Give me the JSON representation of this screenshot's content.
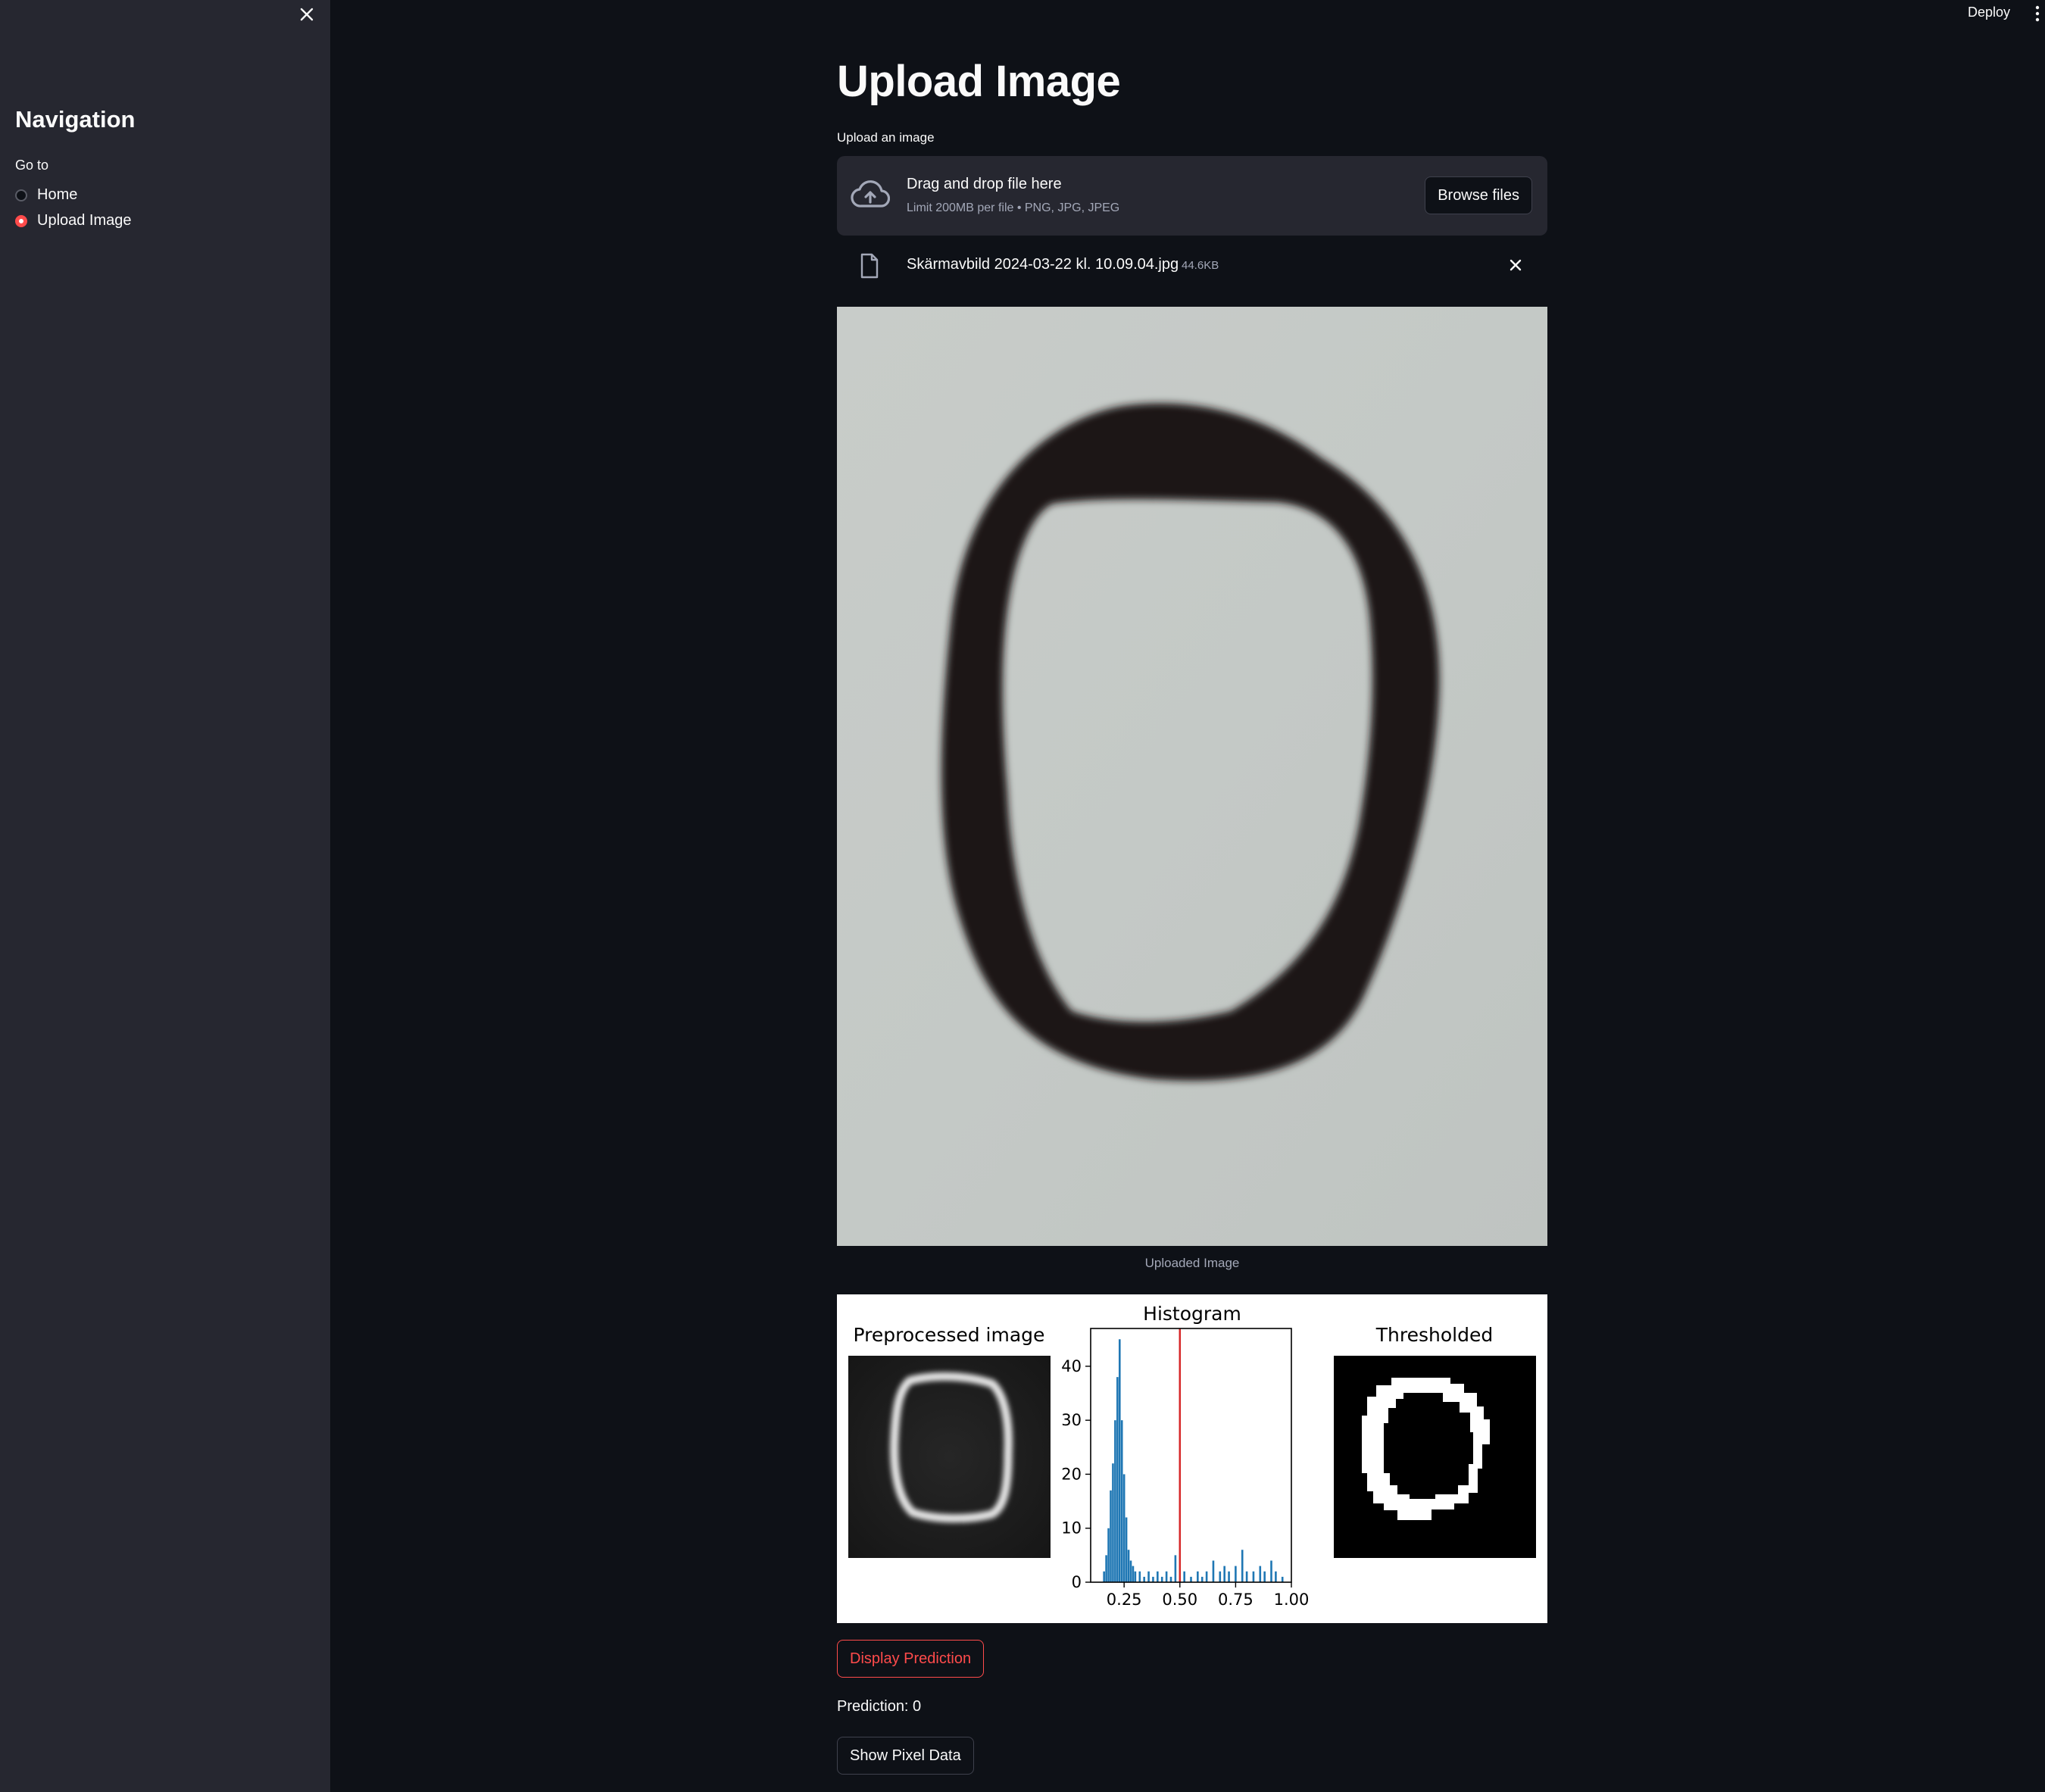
{
  "sidebar": {
    "title": "Navigation",
    "goto_label": "Go to",
    "options": [
      {
        "label": "Home",
        "selected": false
      },
      {
        "label": "Upload Image",
        "selected": true
      }
    ]
  },
  "topbar": {
    "deploy_label": "Deploy"
  },
  "main": {
    "title": "Upload Image",
    "uploader": {
      "label": "Upload an image",
      "drop_text": "Drag and drop file here",
      "limit_text": "Limit 200MB per file • PNG, JPG, JPEG",
      "browse_label": "Browse files"
    },
    "file": {
      "name": "Skärmavbild 2024-03-22 kl. 10.09.04.jpg",
      "size": "44.6KB"
    },
    "image_caption": "Uploaded Image",
    "predict_button": "Display Prediction",
    "prediction_text": "Prediction: 0",
    "pixel_button": "Show Pixel Data"
  },
  "figure": {
    "panels": [
      {
        "title": "Preprocessed image"
      },
      {
        "title": "Histogram"
      },
      {
        "title": "Thresholded"
      }
    ]
  },
  "chart_data": {
    "type": "bar",
    "title": "Histogram",
    "xlabel": "",
    "ylabel": "",
    "xlim": [
      0.1,
      1.0
    ],
    "ylim": [
      0,
      47
    ],
    "xticks": [
      "0.25",
      "0.50",
      "0.75",
      "1.00"
    ],
    "yticks": [
      "0",
      "10",
      "20",
      "30",
      "40"
    ],
    "bar_color": "#1f77b4",
    "threshold": {
      "value": 0.5,
      "color": "#d62728"
    },
    "bins": [
      {
        "x": 0.16,
        "count": 2
      },
      {
        "x": 0.17,
        "count": 5
      },
      {
        "x": 0.18,
        "count": 10
      },
      {
        "x": 0.19,
        "count": 17
      },
      {
        "x": 0.2,
        "count": 22
      },
      {
        "x": 0.21,
        "count": 30
      },
      {
        "x": 0.22,
        "count": 38
      },
      {
        "x": 0.23,
        "count": 45
      },
      {
        "x": 0.24,
        "count": 30
      },
      {
        "x": 0.25,
        "count": 20
      },
      {
        "x": 0.26,
        "count": 12
      },
      {
        "x": 0.27,
        "count": 6
      },
      {
        "x": 0.28,
        "count": 4
      },
      {
        "x": 0.29,
        "count": 3
      },
      {
        "x": 0.3,
        "count": 2
      },
      {
        "x": 0.32,
        "count": 2
      },
      {
        "x": 0.34,
        "count": 1
      },
      {
        "x": 0.36,
        "count": 2
      },
      {
        "x": 0.38,
        "count": 1
      },
      {
        "x": 0.4,
        "count": 2
      },
      {
        "x": 0.42,
        "count": 1
      },
      {
        "x": 0.44,
        "count": 2
      },
      {
        "x": 0.46,
        "count": 1
      },
      {
        "x": 0.48,
        "count": 5
      },
      {
        "x": 0.52,
        "count": 2
      },
      {
        "x": 0.55,
        "count": 1
      },
      {
        "x": 0.58,
        "count": 2
      },
      {
        "x": 0.6,
        "count": 1
      },
      {
        "x": 0.62,
        "count": 2
      },
      {
        "x": 0.65,
        "count": 4
      },
      {
        "x": 0.68,
        "count": 2
      },
      {
        "x": 0.7,
        "count": 3
      },
      {
        "x": 0.72,
        "count": 2
      },
      {
        "x": 0.75,
        "count": 3
      },
      {
        "x": 0.78,
        "count": 6
      },
      {
        "x": 0.8,
        "count": 2
      },
      {
        "x": 0.83,
        "count": 2
      },
      {
        "x": 0.86,
        "count": 3
      },
      {
        "x": 0.88,
        "count": 2
      },
      {
        "x": 0.91,
        "count": 4
      },
      {
        "x": 0.93,
        "count": 2
      },
      {
        "x": 0.96,
        "count": 1
      }
    ]
  }
}
